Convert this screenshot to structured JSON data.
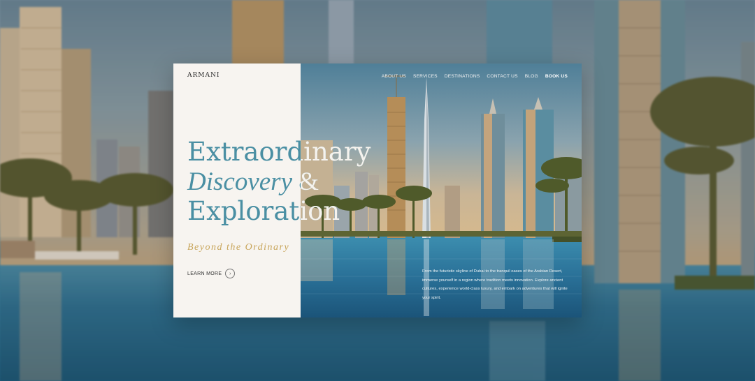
{
  "brand": {
    "logo_text": "ARMANI"
  },
  "nav": {
    "items": [
      {
        "label": "ABOUT US"
      },
      {
        "label": "SERVICES"
      },
      {
        "label": "DESTINATIONS"
      },
      {
        "label": "CONTACT US"
      },
      {
        "label": "BLOG"
      },
      {
        "label": "BOOK US"
      }
    ]
  },
  "hero": {
    "headline_line1": "Extraordinary",
    "headline_line2_italic": "Discovery",
    "headline_line2_amp": " &",
    "headline_line3": "Exploration",
    "tagline": "Beyond the Ordinary",
    "cta_label": "LEARN MORE",
    "cta_icon": "arrow-right-icon",
    "description": "From the futuristic skyline of Dubai to the tranquil oases of the Arabian Desert, immerse yourself in a region where tradition meets innovation. Explore ancient cultures, experience world-class luxury, and embark on adventures that will ignite your spirit."
  },
  "colors": {
    "headline": "#4a8fa3",
    "tagline": "#c8a55a",
    "panel": "#f7f4f0",
    "water": "#2f6f8e"
  }
}
